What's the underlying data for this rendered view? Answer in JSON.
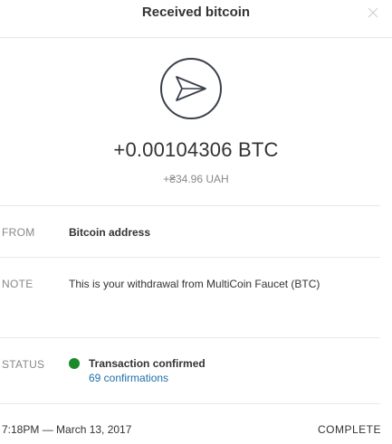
{
  "header": {
    "title": "Received bitcoin",
    "close_icon": "close-icon"
  },
  "transaction": {
    "icon": "send-arrow-icon",
    "amount": "+0.00104306 BTC",
    "fiat_amount": "+₴34.96 UAH"
  },
  "details": {
    "from_label": "FROM",
    "from_value": "Bitcoin address",
    "note_label": "NOTE",
    "note_value": "This is your withdrawal from MultiCoin Faucet (BTC)",
    "status_label": "STATUS",
    "status_value": "Transaction confirmed",
    "status_color": "#1b8a2b",
    "confirmations": "69 confirmations"
  },
  "footer": {
    "timestamp": "7:18PM — March 13, 2017",
    "state": "COMPLETE"
  },
  "colors": {
    "link": "#1f6fa8",
    "muted": "#888888",
    "text": "#333333"
  }
}
